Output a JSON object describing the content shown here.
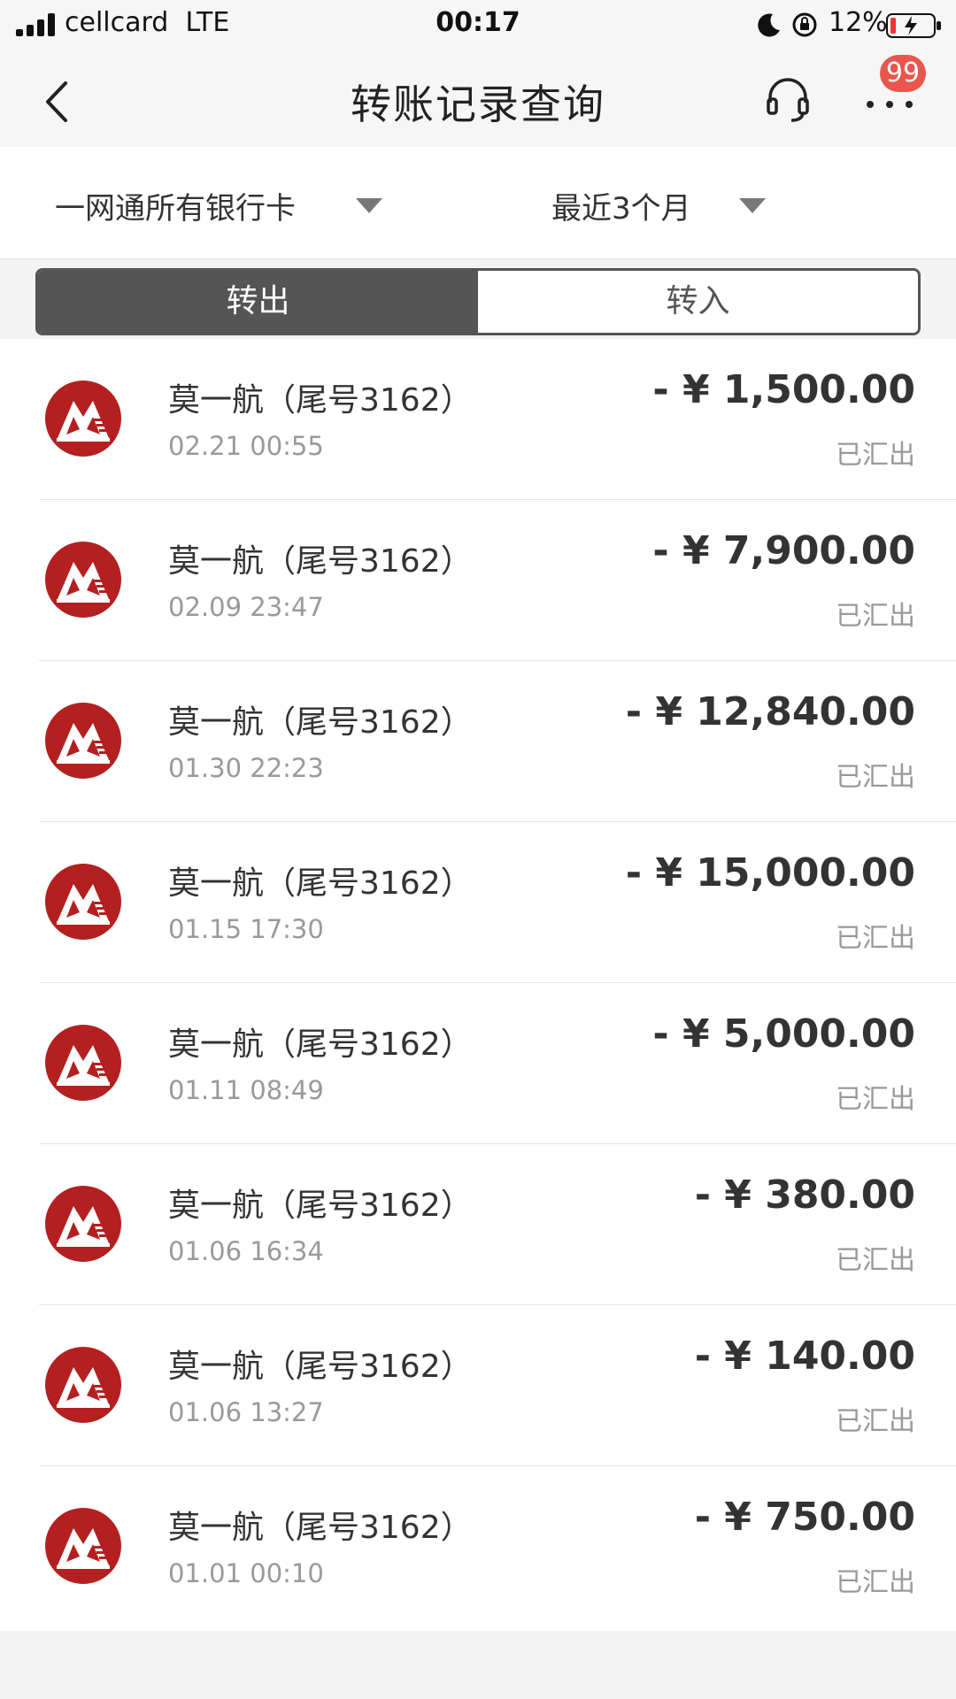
{
  "status_bar": {
    "carrier": "cellcard",
    "network": "LTE",
    "time": "00:17",
    "battery": "12%"
  },
  "nav": {
    "title": "转账记录查询",
    "badge": "99"
  },
  "filters": {
    "card": "一网通所有银行卡",
    "period": "最近3个月"
  },
  "tabs": [
    {
      "label": "转出",
      "selected": true
    },
    {
      "label": "转入",
      "selected": false
    }
  ],
  "colors": {
    "bank_red": "#b3201f",
    "badge_red": "#e8564d",
    "segment_active": "#555555"
  },
  "transactions": [
    {
      "payee": "莫一航（尾号3162）",
      "date": "02.21 00:55",
      "amount": "- ¥ 1,500.00",
      "status": "已汇出"
    },
    {
      "payee": "莫一航（尾号3162）",
      "date": "02.09 23:47",
      "amount": "- ¥ 7,900.00",
      "status": "已汇出"
    },
    {
      "payee": "莫一航（尾号3162）",
      "date": "01.30 22:23",
      "amount": "- ¥ 12,840.00",
      "status": "已汇出"
    },
    {
      "payee": "莫一航（尾号3162）",
      "date": "01.15 17:30",
      "amount": "- ¥ 15,000.00",
      "status": "已汇出"
    },
    {
      "payee": "莫一航（尾号3162）",
      "date": "01.11 08:49",
      "amount": "- ¥ 5,000.00",
      "status": "已汇出"
    },
    {
      "payee": "莫一航（尾号3162）",
      "date": "01.06 16:34",
      "amount": "- ¥ 380.00",
      "status": "已汇出"
    },
    {
      "payee": "莫一航（尾号3162）",
      "date": "01.06 13:27",
      "amount": "- ¥ 140.00",
      "status": "已汇出"
    },
    {
      "payee": "莫一航（尾号3162）",
      "date": "01.01 00:10",
      "amount": "- ¥ 750.00",
      "status": "已汇出"
    }
  ]
}
